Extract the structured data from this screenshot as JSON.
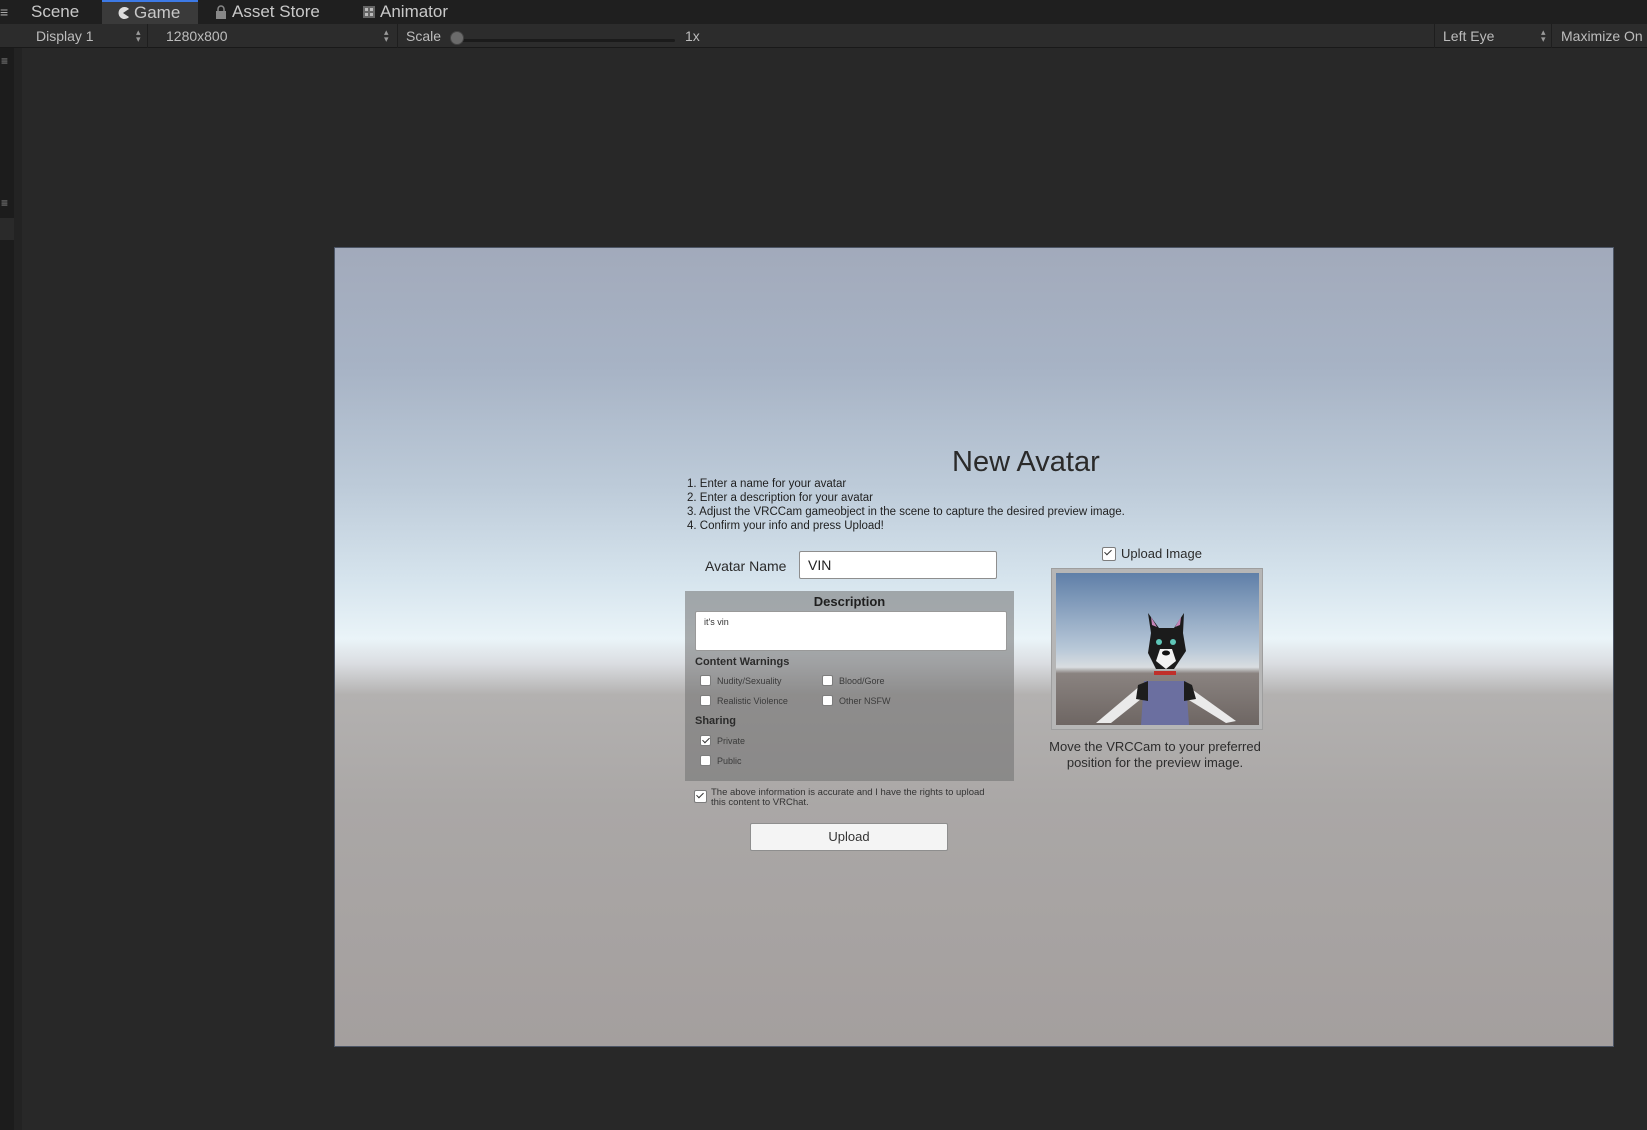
{
  "tabs": [
    {
      "label": "Scene",
      "icon": "scene-icon",
      "active": false
    },
    {
      "label": "Game",
      "icon": "pacman-icon",
      "active": true
    },
    {
      "label": "Asset Store",
      "icon": "lock-icon",
      "active": false
    },
    {
      "label": "Animator",
      "icon": "film-icon",
      "active": false
    }
  ],
  "toolbar": {
    "display": "Display 1",
    "resolution": "1280x800",
    "scale_label": "Scale",
    "scale_value_text": "1x",
    "scale_value": 1,
    "eye": "Left Eye",
    "maximize": "Maximize On"
  },
  "game": {
    "title": "New Avatar",
    "steps": [
      "1. Enter a name for your avatar",
      "2. Enter a description for your avatar",
      "3. Adjust the VRCCam gameobject in the scene to capture the desired preview image.",
      "4. Confirm your info and press Upload!"
    ],
    "avatar_name_label": "Avatar Name",
    "avatar_name_value": "VIN",
    "description_title": "Description",
    "description_value": "it's vin",
    "content_warnings_title": "Content Warnings",
    "warnings": [
      {
        "label": "Nudity/Sexuality",
        "checked": false
      },
      {
        "label": "Blood/Gore",
        "checked": false
      },
      {
        "label": "Realistic Violence",
        "checked": false
      },
      {
        "label": "Other NSFW",
        "checked": false
      }
    ],
    "sharing_title": "Sharing",
    "sharing": [
      {
        "label": "Private",
        "checked": true
      },
      {
        "label": "Public",
        "checked": false
      }
    ],
    "rights_text": "The above information is accurate and I have the rights to upload this content to VRChat.",
    "rights_checked": true,
    "upload_button": "Upload",
    "upload_image_label": "Upload Image",
    "upload_image_checked": true,
    "preview_caption": "Move the VRCCam to your preferred position for the preview image."
  },
  "colors": {
    "editor_bg": "#282828",
    "active_tab_accent": "#3d7ae6",
    "sky_top": "#a2aabb",
    "horizon": "#eaf4f8",
    "ground": "#a49f9e"
  }
}
